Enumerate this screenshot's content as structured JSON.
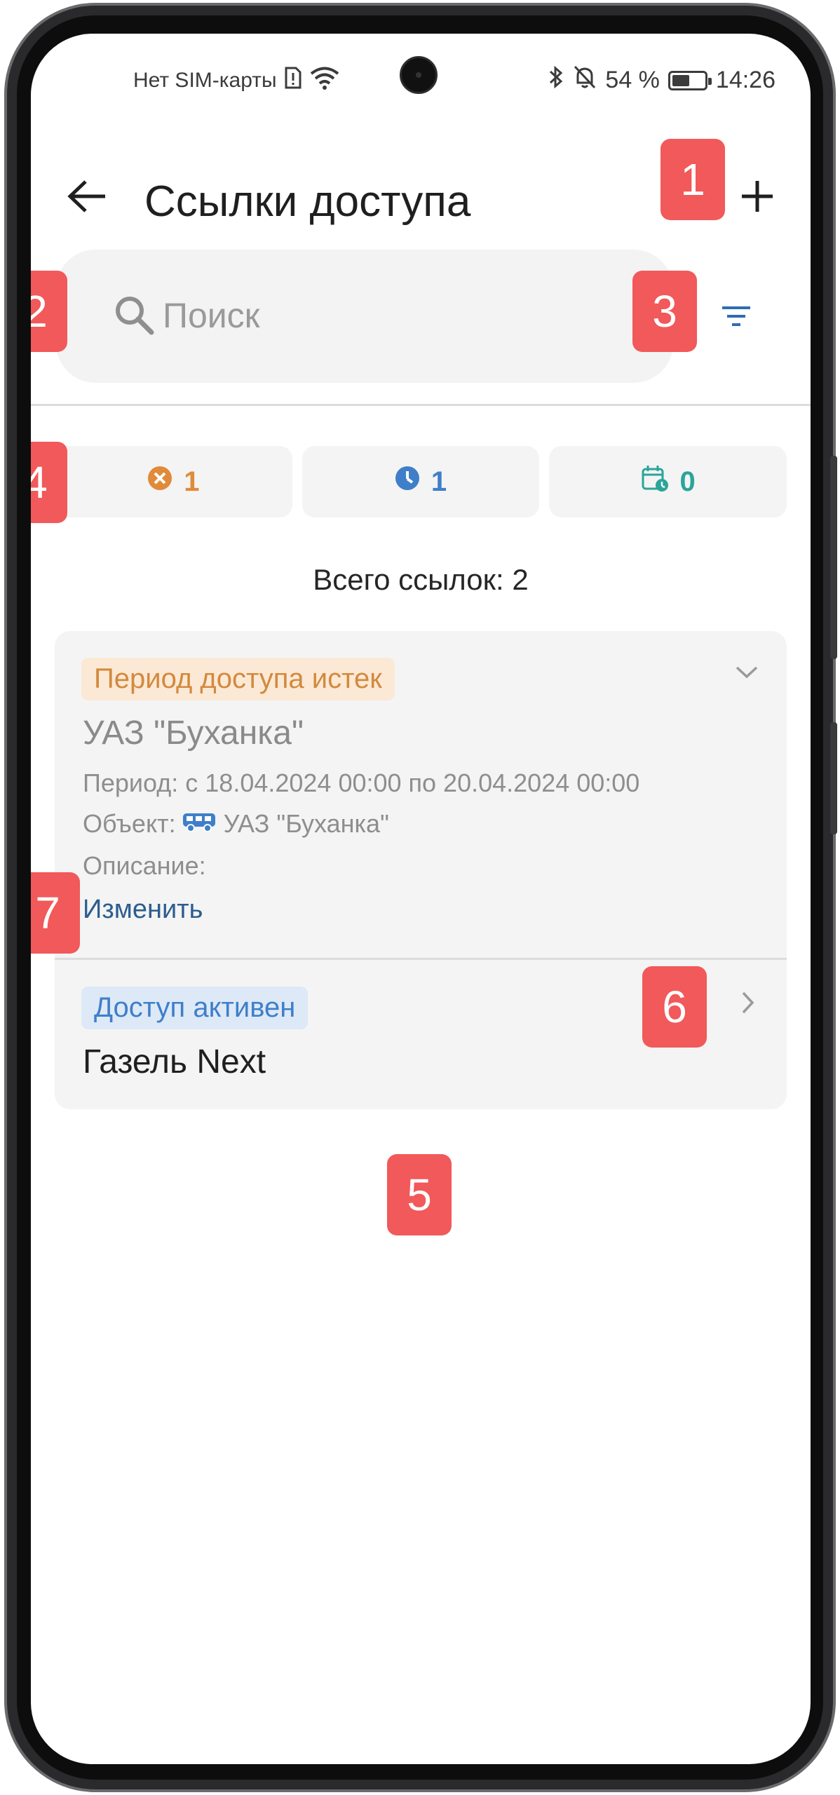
{
  "status_bar": {
    "sim_text": "Нет SIM-карты",
    "battery_percent": "54 %",
    "battery_level": 0.54,
    "time": "14:26"
  },
  "header": {
    "title": "Ссылки доступа",
    "back_icon": "arrow-left-icon",
    "add_icon": "plus-icon"
  },
  "search": {
    "placeholder": "Поиск",
    "value": ""
  },
  "counters": [
    {
      "icon": "x-circle-icon",
      "count": "1",
      "color": "#e08a3a"
    },
    {
      "icon": "clock-icon",
      "count": "1",
      "color": "#3f7fc9"
    },
    {
      "icon": "calendar-clock-icon",
      "count": "0",
      "color": "#2aa59a"
    }
  ],
  "total": "Всего ссылок: 2",
  "items": [
    {
      "status": "Период доступа истек",
      "name": "УАЗ \"Буханка\"",
      "period": "Период: с 18.04.2024 00:00 по 20.04.2024 00:00",
      "object_label": "Объект:",
      "object_name": "УАЗ \"Буханка\"",
      "description": "Описание:",
      "edit": "Изменить"
    },
    {
      "status": "Доступ активен",
      "name": "Газель Next"
    }
  ],
  "callouts": [
    "1",
    "2",
    "3",
    "4",
    "5",
    "6",
    "7"
  ],
  "colors": {
    "expired_text": "#d4893d",
    "expired_bg": "#fbe9d6",
    "active_text": "#3f7fc9",
    "active_bg": "#dde9f7",
    "link": "#2c5d8f",
    "callout": "#f1595a",
    "accent": "#2f6db3"
  }
}
